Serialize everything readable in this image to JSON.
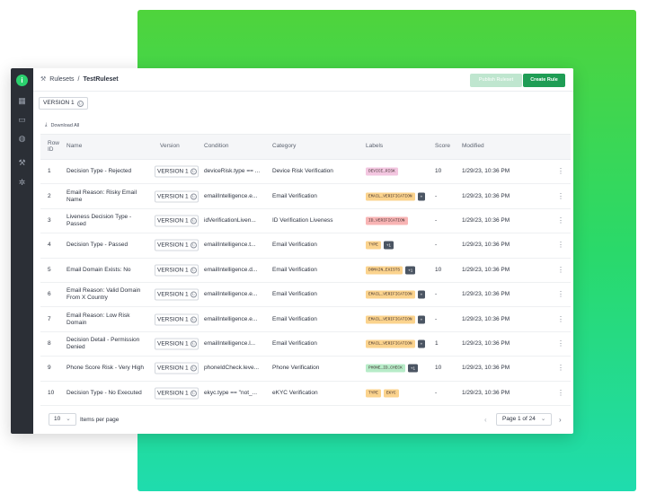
{
  "breadcrumb": {
    "root": "Rulesets",
    "separator": "/",
    "current": "TestRuleset"
  },
  "buttons": {
    "publish": "Publish Ruleset",
    "create": "Create Rule"
  },
  "version_selector": "VERSION 1",
  "download_label": "Download All",
  "columns": [
    "Row ID",
    "Name",
    "Version",
    "Condition",
    "Category",
    "Labels",
    "Score",
    "Modified"
  ],
  "rows": [
    {
      "id": "1",
      "name": "Decision Type - Rejected",
      "version": "VERSION 1",
      "condition": "deviceRisk.type == ...",
      "category": "Device Risk Verification",
      "labels": [
        {
          "text": "DEVICE_RISK",
          "color": "#f3c6e0"
        }
      ],
      "more": "",
      "score": "10",
      "modified": "1/29/23, 10:36 PM"
    },
    {
      "id": "2",
      "name": "Email Reason: Risky Email Name",
      "version": "VERSION 1",
      "condition": "emailIntelligence.e...",
      "category": "Email Verification",
      "labels": [
        {
          "text": "EMAIL_VERIFICATION",
          "color": "#fbd38d"
        }
      ],
      "more": "+",
      "score": "-",
      "modified": "1/29/23, 10:36 PM"
    },
    {
      "id": "3",
      "name": "Liveness Decision Type - Passed",
      "version": "VERSION 1",
      "condition": "idVerificationLiven...",
      "category": "ID Verification Liveness",
      "labels": [
        {
          "text": "ID_VERIFICATION",
          "color": "#f8b4b4"
        }
      ],
      "more": "",
      "score": "-",
      "modified": "1/29/23, 10:36 PM"
    },
    {
      "id": "4",
      "name": "Decision Type - Passed",
      "version": "VERSION 1",
      "condition": "emailIntelligence.t...",
      "category": "Email Verification",
      "labels": [
        {
          "text": "TYPE",
          "color": "#fbd38d"
        }
      ],
      "more": "+1",
      "score": "-",
      "modified": "1/29/23, 10:36 PM"
    },
    {
      "id": "5",
      "name": "Email Domain Exists: No",
      "version": "VERSION 1",
      "condition": "emailIntelligence.d...",
      "category": "Email Verification",
      "labels": [
        {
          "text": "DOMAIN_EXISTS",
          "color": "#fbd38d"
        }
      ],
      "more": "+1",
      "score": "10",
      "modified": "1/29/23, 10:36 PM"
    },
    {
      "id": "6",
      "name": "Email Reason: Valid Domain From X Country",
      "version": "VERSION 1",
      "condition": "emailIntelligence.e...",
      "category": "Email Verification",
      "labels": [
        {
          "text": "EMAIL_VERIFICATION",
          "color": "#fbd38d"
        }
      ],
      "more": "+",
      "score": "-",
      "modified": "1/29/23, 10:36 PM"
    },
    {
      "id": "7",
      "name": "Email Reason: Low Risk Domain",
      "version": "VERSION 1",
      "condition": "emailIntelligence.e...",
      "category": "Email Verification",
      "labels": [
        {
          "text": "EMAIL_VERIFICATION",
          "color": "#fbd38d"
        }
      ],
      "more": "+",
      "score": "-",
      "modified": "1/29/23, 10:36 PM"
    },
    {
      "id": "8",
      "name": "Decision Detail - Permission Denied",
      "version": "VERSION 1",
      "condition": "emailIntelligence.l...",
      "category": "Email Verification",
      "labels": [
        {
          "text": "EMAIL_VERIFICATION",
          "color": "#fbd38d"
        }
      ],
      "more": "+",
      "score": "1",
      "modified": "1/29/23, 10:36 PM"
    },
    {
      "id": "9",
      "name": "Phone Score Risk - Very High",
      "version": "VERSION 1",
      "condition": "phoneIdCheck.leve...",
      "category": "Phone Verification",
      "labels": [
        {
          "text": "PHONE_ID_CHECK",
          "color": "#b7ecc8"
        }
      ],
      "more": "+1",
      "score": "10",
      "modified": "1/29/23, 10:36 PM"
    },
    {
      "id": "10",
      "name": "Decision Type - No Executed",
      "version": "VERSION 1",
      "condition": "ekyc.type == \"not_...",
      "category": "eKYC Verification",
      "labels": [
        {
          "text": "TYPE",
          "color": "#fbd38d"
        },
        {
          "text": "EKYC",
          "color": "#fbd38d"
        }
      ],
      "more": "",
      "score": "-",
      "modified": "1/29/23, 10:36 PM"
    }
  ],
  "footer": {
    "per_page": "10",
    "per_page_label": "Items per page",
    "page_label": "Page 1 of 24"
  }
}
